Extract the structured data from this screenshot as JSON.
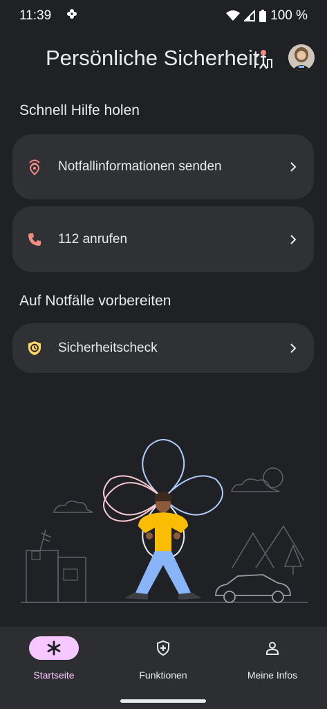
{
  "status_bar": {
    "time": "11:39",
    "battery": "100 %",
    "icons": [
      "pinwheel-icon",
      "wifi-icon",
      "signal-icon",
      "battery-icon"
    ]
  },
  "header": {
    "title": "Persönliche Sicherheit",
    "title_icon": "safety-illustration-icon",
    "avatar": "avatar"
  },
  "sections": {
    "quick_help": {
      "heading": "Schnell Hilfe holen",
      "items": [
        {
          "label": "Notfallinformationen senden",
          "icon": "location-share-icon"
        },
        {
          "label": "112 anrufen",
          "icon": "phone-icon"
        }
      ]
    },
    "prepare": {
      "heading": "Auf Notfälle vorbereiten",
      "items": [
        {
          "label": "Sicherheitscheck",
          "icon": "safety-check-icon"
        }
      ]
    }
  },
  "bottom_nav": {
    "items": [
      {
        "label": "Startseite",
        "icon": "asterisk-icon",
        "active": true
      },
      {
        "label": "Funktionen",
        "icon": "shield-plus-icon",
        "active": false
      },
      {
        "label": "Meine Infos",
        "icon": "person-icon",
        "active": false
      }
    ]
  },
  "colors": {
    "background": "#202124",
    "card": "#303134",
    "nav_background": "#2d2e31",
    "active_pill": "#f6c8ff",
    "accent_red": "#f28b82",
    "accent_yellow": "#fdd663"
  }
}
